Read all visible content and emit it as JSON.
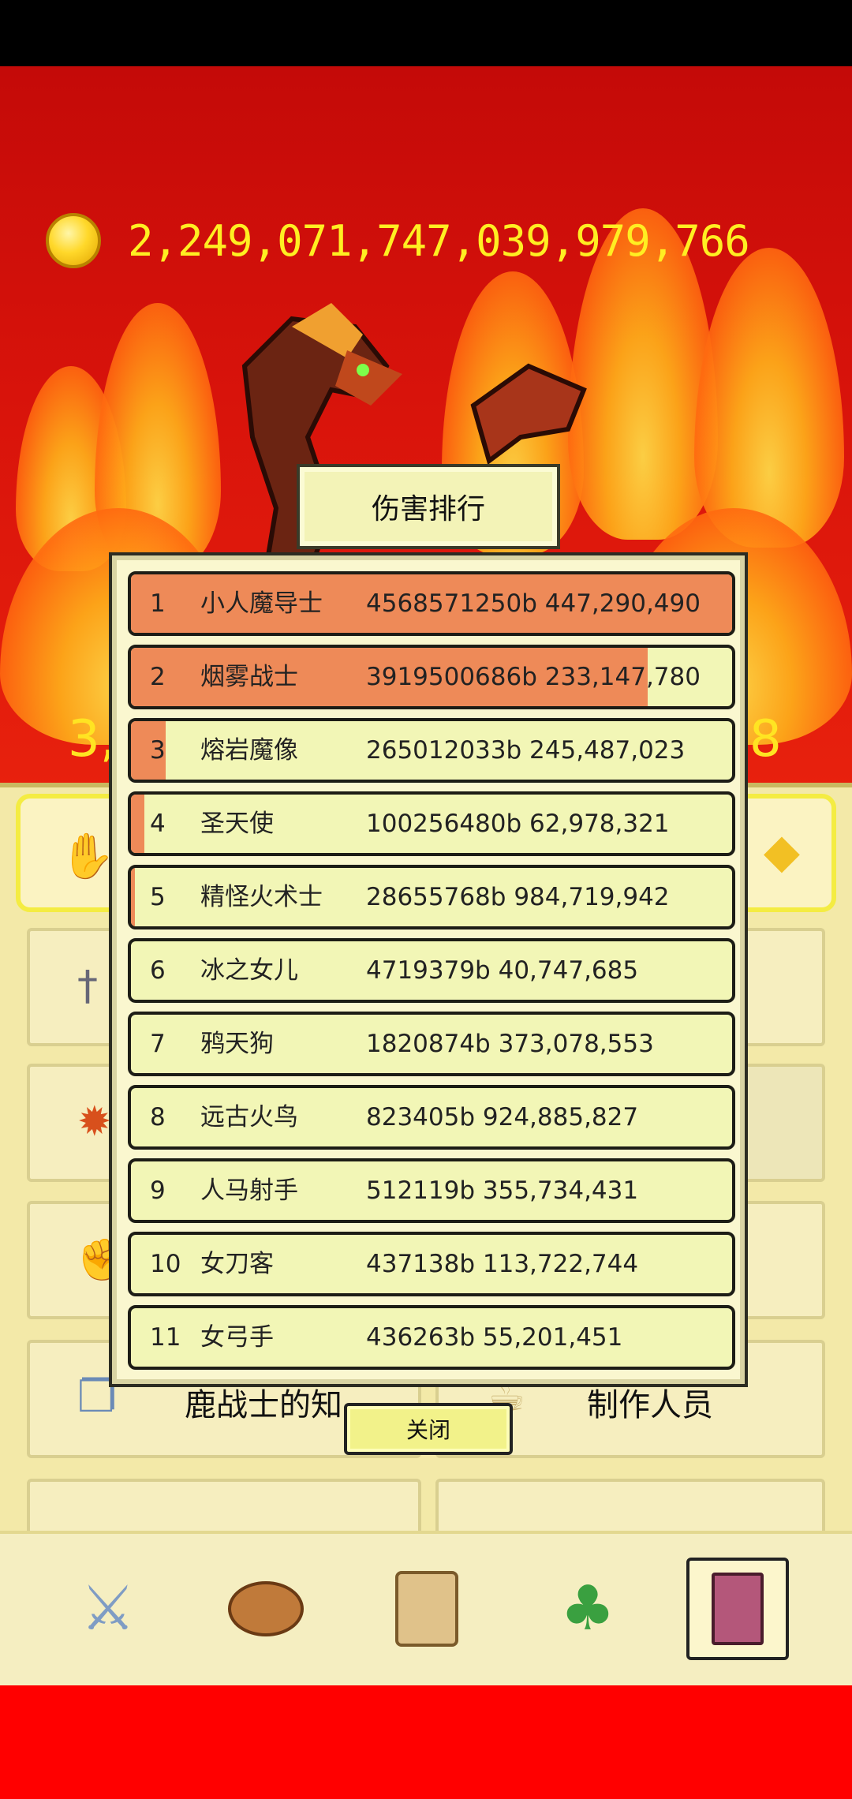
{
  "coins": "2,249,071,747,039,979,766",
  "partial_left": "3,",
  "partial_right": "8",
  "panel": {
    "knowledge_label": "鹿战士的知",
    "credits_label": "制作人员"
  },
  "dialog": {
    "title": "伤害排行",
    "close_label": "关闭",
    "rows": [
      {
        "rank": "1",
        "name": "小人魔导士",
        "value": "4568571250b 447,290,490",
        "fill": 1.0
      },
      {
        "rank": "2",
        "name": "烟雾战士",
        "value": "3919500686b 233,147,780",
        "fill": 0.86
      },
      {
        "rank": "3",
        "name": "熔岩魔像",
        "value": "265012033b 245,487,023",
        "fill": 0.058
      },
      {
        "rank": "4",
        "name": "圣天使",
        "value": "100256480b 62,978,321",
        "fill": 0.022
      },
      {
        "rank": "5",
        "name": "精怪火术士",
        "value": "28655768b 984,719,942",
        "fill": 0.006
      },
      {
        "rank": "6",
        "name": "冰之女儿",
        "value": "4719379b 40,747,685",
        "fill": 0.0
      },
      {
        "rank": "7",
        "name": "鸦天狗",
        "value": "1820874b 373,078,553",
        "fill": 0.0
      },
      {
        "rank": "8",
        "name": "远古火鸟",
        "value": "823405b 924,885,827",
        "fill": 0.0
      },
      {
        "rank": "9",
        "name": "人马射手",
        "value": "512119b 355,734,431",
        "fill": 0.0
      },
      {
        "rank": "10",
        "name": "女刀客",
        "value": "437138b 113,722,744",
        "fill": 0.0
      },
      {
        "rank": "11",
        "name": "女弓手",
        "value": "436263b 55,201,451",
        "fill": 0.0
      }
    ]
  },
  "nav": {
    "items": [
      {
        "icon": "sword-icon",
        "selected": false
      },
      {
        "icon": "bread-icon",
        "selected": false
      },
      {
        "icon": "scroll-icon",
        "selected": false
      },
      {
        "icon": "clover-icon",
        "selected": false
      },
      {
        "icon": "book-icon",
        "selected": true
      }
    ]
  },
  "colors": {
    "bar_fill": "#ee8a58",
    "row_bg": "#f2f6b6",
    "coin_text": "#ffee22"
  }
}
